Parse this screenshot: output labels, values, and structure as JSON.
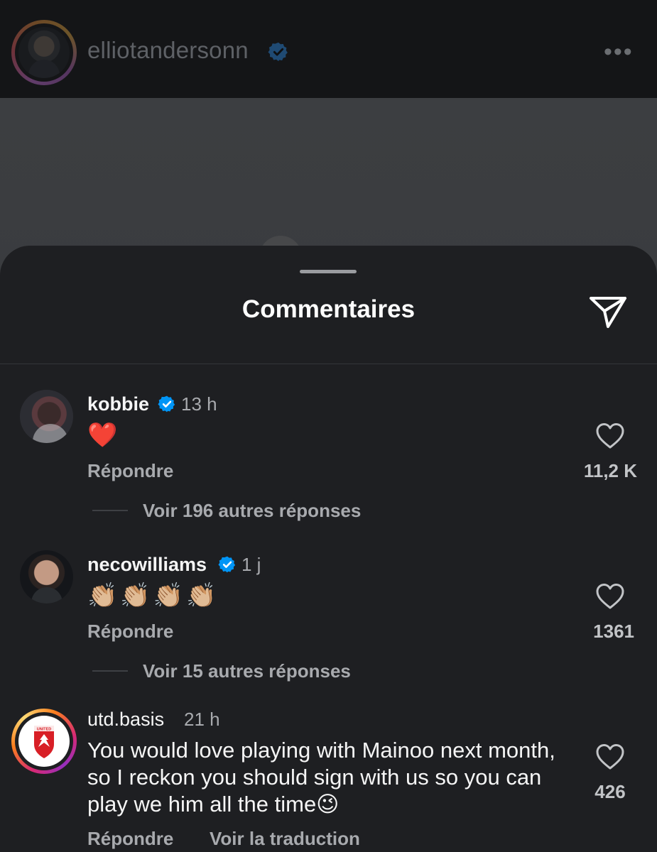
{
  "post_header": {
    "username": "elliotandersonn",
    "verified_icon": "verified-badge-icon",
    "more_icon": "more-horizontal-icon",
    "more_label": "•••"
  },
  "sheet": {
    "title": "Commentaires",
    "share_icon": "paper-plane-icon"
  },
  "comments": [
    {
      "username": "kobbie",
      "verified": true,
      "time": "13 h",
      "text": "❤️",
      "reply_label": "Répondre",
      "likes": "11,2 K",
      "more_replies": "Voir 196 autres réponses"
    },
    {
      "username": "necowilliams",
      "verified": true,
      "time": "1 j",
      "text": "👏🏼👏🏼👏🏼👏🏼",
      "reply_label": "Répondre",
      "likes": "1361",
      "more_replies": "Voir 15 autres réponses"
    },
    {
      "username": "utd.basis",
      "verified": false,
      "time": "21 h",
      "text": "You would love playing with Mainoo next month, so I reckon you should sign with us so you can play we him all the time😉",
      "reply_label": "Répondre",
      "translate_label": "Voir la traduction",
      "likes": "426",
      "avatar_text": "UNITED"
    }
  ],
  "colors": {
    "verified_blue": "#0095f6",
    "heart_red": "#ff3040",
    "sheet_bg": "#1e1f22"
  }
}
